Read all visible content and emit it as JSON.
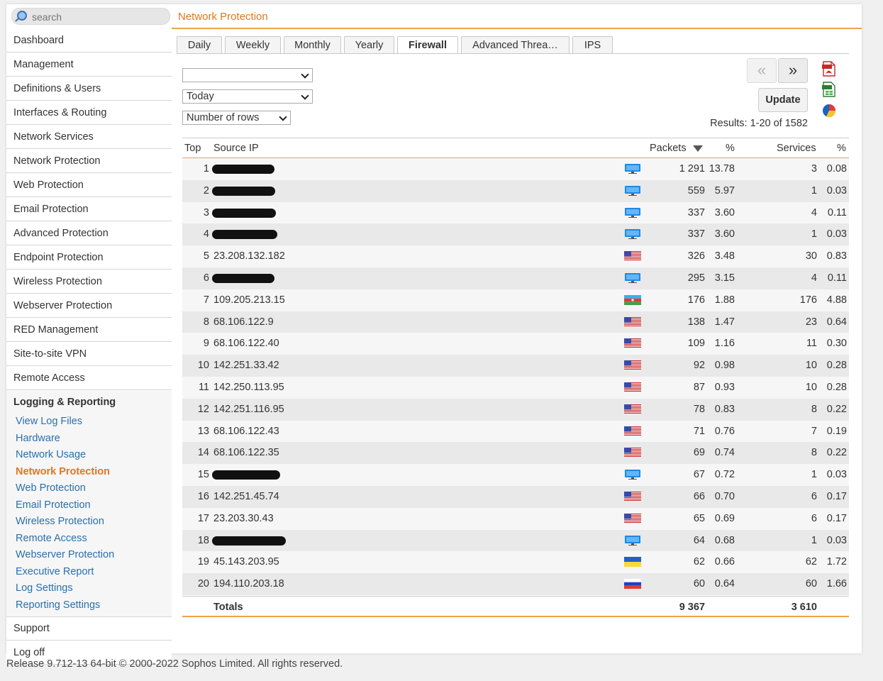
{
  "search": {
    "placeholder": "search"
  },
  "page_title": "Network Protection",
  "sidebar": {
    "items_top": [
      "Dashboard",
      "Management",
      "Definitions & Users",
      "Interfaces & Routing",
      "Network Services",
      "Network Protection",
      "Web Protection",
      "Email Protection",
      "Advanced Protection",
      "Endpoint Protection",
      "Wireless Protection",
      "Webserver Protection",
      "RED Management",
      "Site-to-site VPN",
      "Remote Access"
    ],
    "section_title": "Logging & Reporting",
    "sub_items": [
      "View Log Files",
      "Hardware",
      "Network Usage",
      "Network Protection",
      "Web Protection",
      "Email Protection",
      "Wireless Protection",
      "Remote Access",
      "Webserver Protection",
      "Executive Report",
      "Log Settings",
      "Reporting Settings"
    ],
    "active_sub_item": "Network Protection",
    "items_bottom": [
      "Support",
      "Log off"
    ]
  },
  "tabs": [
    "Daily",
    "Weekly",
    "Monthly",
    "Yearly",
    "Firewall",
    "Advanced Threa…",
    "IPS"
  ],
  "active_tab": "Firewall",
  "filters": {
    "select1": "",
    "select2": "Today",
    "select3": "Number of rows"
  },
  "buttons": {
    "prev": "«",
    "next": "»",
    "update": "Update"
  },
  "export_icons": [
    "pdf-export-icon",
    "xls-export-icon",
    "chart-icon"
  ],
  "results_text": "Results: 1-20 of 1582",
  "table": {
    "headers": {
      "top": "Top",
      "source_ip": "Source IP",
      "packets": "Packets",
      "packets_pct": "%",
      "services": "Services",
      "services_pct": "%"
    },
    "rows": [
      {
        "top": "1",
        "ip": "",
        "redacted": true,
        "flag": "monitor",
        "packets": "1 291",
        "ppct": "13.78",
        "services": "3",
        "spct": "0.08"
      },
      {
        "top": "2",
        "ip": "",
        "redacted": true,
        "flag": "monitor",
        "packets": "559",
        "ppct": "5.97",
        "services": "1",
        "spct": "0.03"
      },
      {
        "top": "3",
        "ip": "",
        "redacted": true,
        "flag": "monitor",
        "packets": "337",
        "ppct": "3.60",
        "services": "4",
        "spct": "0.11"
      },
      {
        "top": "4",
        "ip": "",
        "redacted": true,
        "flag": "monitor",
        "packets": "337",
        "ppct": "3.60",
        "services": "1",
        "spct": "0.03"
      },
      {
        "top": "5",
        "ip": "23.208.132.182",
        "redacted": false,
        "flag": "us",
        "packets": "326",
        "ppct": "3.48",
        "services": "30",
        "spct": "0.83"
      },
      {
        "top": "6",
        "ip": "",
        "redacted": true,
        "flag": "monitor",
        "packets": "295",
        "ppct": "3.15",
        "services": "4",
        "spct": "0.11"
      },
      {
        "top": "7",
        "ip": "109.205.213.15",
        "redacted": false,
        "flag": "az",
        "packets": "176",
        "ppct": "1.88",
        "services": "176",
        "spct": "4.88"
      },
      {
        "top": "8",
        "ip": "68.106.122.9",
        "redacted": false,
        "flag": "us",
        "packets": "138",
        "ppct": "1.47",
        "services": "23",
        "spct": "0.64"
      },
      {
        "top": "9",
        "ip": "68.106.122.40",
        "redacted": false,
        "flag": "us",
        "packets": "109",
        "ppct": "1.16",
        "services": "11",
        "spct": "0.30"
      },
      {
        "top": "10",
        "ip": "142.251.33.42",
        "redacted": false,
        "flag": "us",
        "packets": "92",
        "ppct": "0.98",
        "services": "10",
        "spct": "0.28"
      },
      {
        "top": "11",
        "ip": "142.250.113.95",
        "redacted": false,
        "flag": "us",
        "packets": "87",
        "ppct": "0.93",
        "services": "10",
        "spct": "0.28"
      },
      {
        "top": "12",
        "ip": "142.251.116.95",
        "redacted": false,
        "flag": "us",
        "packets": "78",
        "ppct": "0.83",
        "services": "8",
        "spct": "0.22"
      },
      {
        "top": "13",
        "ip": "68.106.122.43",
        "redacted": false,
        "flag": "us",
        "packets": "71",
        "ppct": "0.76",
        "services": "7",
        "spct": "0.19"
      },
      {
        "top": "14",
        "ip": "68.106.122.35",
        "redacted": false,
        "flag": "us",
        "packets": "69",
        "ppct": "0.74",
        "services": "8",
        "spct": "0.22"
      },
      {
        "top": "15",
        "ip": "",
        "redacted": true,
        "flag": "monitor",
        "packets": "67",
        "ppct": "0.72",
        "services": "1",
        "spct": "0.03"
      },
      {
        "top": "16",
        "ip": "142.251.45.74",
        "redacted": false,
        "flag": "us",
        "packets": "66",
        "ppct": "0.70",
        "services": "6",
        "spct": "0.17"
      },
      {
        "top": "17",
        "ip": "23.203.30.43",
        "redacted": false,
        "flag": "us",
        "packets": "65",
        "ppct": "0.69",
        "services": "6",
        "spct": "0.17"
      },
      {
        "top": "18",
        "ip": "",
        "redacted": true,
        "flag": "monitor",
        "packets": "64",
        "ppct": "0.68",
        "services": "1",
        "spct": "0.03"
      },
      {
        "top": "19",
        "ip": "45.143.203.95",
        "redacted": false,
        "flag": "ua",
        "packets": "62",
        "ppct": "0.66",
        "services": "62",
        "spct": "1.72"
      },
      {
        "top": "20",
        "ip": "194.110.203.18",
        "redacted": false,
        "flag": "ru",
        "packets": "60",
        "ppct": "0.64",
        "services": "60",
        "spct": "1.66"
      }
    ],
    "totals": {
      "label": "Totals",
      "packets": "9 367",
      "services": "3 610"
    }
  },
  "footer": "Release 9.712-13 64-bit  © 2000-2022 Sophos Limited. All rights reserved.",
  "colors": {
    "accent": "#e0761e",
    "link": "#2a6fae"
  }
}
